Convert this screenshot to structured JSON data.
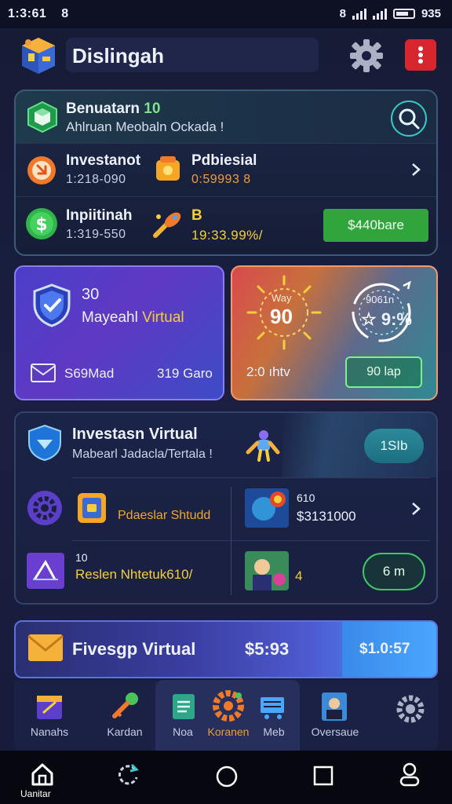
{
  "status_bar": {
    "time": "1:3:61",
    "notif_glyph": "8",
    "right_glyph": "8",
    "battery_text": "935"
  },
  "header": {
    "app_title": "Dislingah"
  },
  "wallet_card": {
    "header_title": "Benuatarn",
    "header_title_num": "10",
    "header_subtitle": "Ahlruan Meobaln Ockada !",
    "rows": [
      {
        "title": "Investanot",
        "value": "1:218-090"
      },
      {
        "title": "Pdbiesial",
        "value": "0:59993 8"
      },
      {
        "title": "Inpiitinah",
        "value": "1:319-550"
      },
      {
        "title": "B",
        "value": "19:33.99%/"
      }
    ],
    "earn_button": "$440bare"
  },
  "tile_left": {
    "number": "30",
    "label_white": "Mayeahl",
    "label_accent": "Virtual",
    "footer_left": "S69Mad",
    "footer_right": "319 Garo"
  },
  "tile_right": {
    "ring_top": "Way",
    "ring_value": "90",
    "ring2_top": "9061n",
    "ring2_value": "9:%",
    "footer_left": "2:0 ıhtv",
    "day_button": "90 lap"
  },
  "invest_card": {
    "title": "Investasn Virtual",
    "subtitle": "Mabearl Jadacla/Tertala !",
    "pill_button": "1SIb",
    "item_a_label": "Pdaeslar Shtudd",
    "item_b_top": "610",
    "item_b_value": "$3131000",
    "item_c_top": "10",
    "item_c_label": "Reslen Nhtetuk610/",
    "item_d_value": "4",
    "count_button": "6 m"
  },
  "banner": {
    "title": "Fivesgp Virtual",
    "price": "$5:93",
    "right_value": "$1.0:57"
  },
  "app_nav": {
    "items": [
      {
        "label": "Nanahs"
      },
      {
        "label": "Kardan"
      },
      {
        "label": "Noa"
      },
      {
        "label": "Koranen"
      },
      {
        "label": "Meb"
      },
      {
        "label": "Oversaue"
      },
      {
        "label": ""
      }
    ]
  },
  "sys_nav": {
    "home_label": "Uanitar"
  },
  "colors": {
    "accent_green": "#2fa53c",
    "accent_gold": "#f5cf3a",
    "accent_orange": "#f29a3c",
    "danger_red": "#d8262f",
    "teal": "#39c8c4"
  }
}
